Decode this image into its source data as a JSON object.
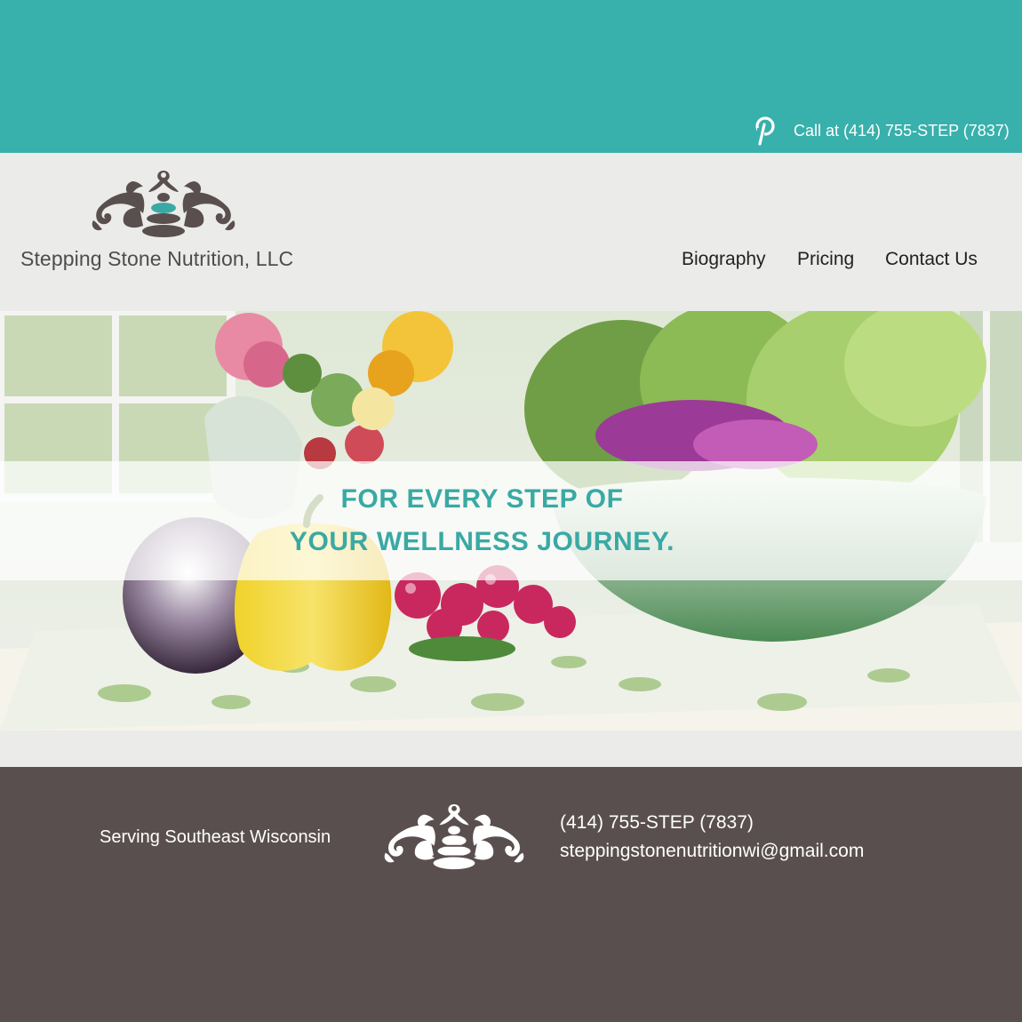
{
  "topbar": {
    "phone_text": "Call at (414) 755-STEP (7837)",
    "pinterest_icon": "pinterest-icon",
    "background_color": "#38b0ab"
  },
  "header": {
    "brand_name": "Stepping Stone Nutrition, LLC",
    "logo_icon": "stacked-stones-ornament-icon",
    "nav": [
      {
        "label": "Biography"
      },
      {
        "label": "Pricing"
      },
      {
        "label": "Contact Us"
      }
    ]
  },
  "hero": {
    "tagline_line1": "FOR EVERY STEP OF",
    "tagline_line2": "YOUR WELLNESS JOURNEY.",
    "image_subject": "vegetables-on-table-photo",
    "accent_color": "#3aa9a4"
  },
  "footer": {
    "serving_text": "Serving Southeast Wisconsin",
    "phone": "(414) 755-STEP (7837)",
    "email": "steppingstonenutritionwi@gmail.com",
    "logo_icon": "stacked-stones-ornament-icon",
    "background_color": "#594f4e"
  }
}
